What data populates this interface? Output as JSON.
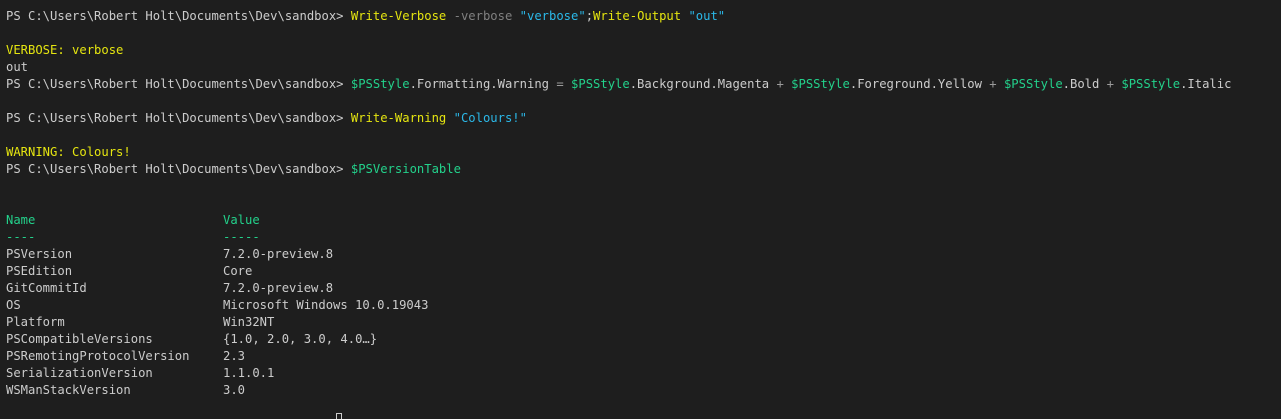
{
  "prompt": "PS C:\\Users\\Robert Holt\\Documents\\Dev\\sandbox> ",
  "commands": {
    "cmd1": {
      "cmdlet": "Write-Verbose",
      "param": "-verbose",
      "arg": "\"verbose\"",
      "separator": ";",
      "cmdlet2": "Write-Output",
      "arg2": "\"out\""
    },
    "cmd2": {
      "var1": "$PSStyle",
      "prop1": ".Formatting.Warning",
      "eq": " = ",
      "var2": "$PSStyle",
      "prop2": ".Background.Magenta",
      "plus1": " + ",
      "var3": "$PSStyle",
      "prop3": ".Foreground.Yellow",
      "plus2": " + ",
      "var4": "$PSStyle",
      "prop4": ".Bold",
      "plus3": " + ",
      "var5": "$PSStyle",
      "prop5": ".Italic"
    },
    "cmd3": {
      "cmdlet": "Write-Warning",
      "arg": "\"Colours!\""
    },
    "cmd4": {
      "var": "$PSVersionTable"
    }
  },
  "output": {
    "verbose_line": "VERBOSE: verbose",
    "out_line": "out",
    "warning_line": "WARNING: Colours!"
  },
  "table": {
    "header_name": "Name",
    "header_value": "Value",
    "underline_name": "----",
    "underline_value": "-----",
    "rows": [
      {
        "name": "PSVersion",
        "value": "7.2.0-preview.8"
      },
      {
        "name": "PSEdition",
        "value": "Core"
      },
      {
        "name": "GitCommitId",
        "value": "7.2.0-preview.8"
      },
      {
        "name": "OS",
        "value": "Microsoft Windows 10.0.19043"
      },
      {
        "name": "Platform",
        "value": "Win32NT"
      },
      {
        "name": "PSCompatibleVersions",
        "value": "{1.0, 2.0, 3.0, 4.0…}"
      },
      {
        "name": "PSRemotingProtocolVersion",
        "value": "2.3"
      },
      {
        "name": "SerializationVersion",
        "value": "1.1.0.1"
      },
      {
        "name": "WSManStackVersion",
        "value": "3.0"
      }
    ]
  },
  "colors": {
    "background": "#1e1e1e",
    "text": "#cccccc",
    "cmdlet": "#e5e510",
    "string": "#2bb8e8",
    "variable": "#23d18b",
    "parameter": "#808080"
  }
}
